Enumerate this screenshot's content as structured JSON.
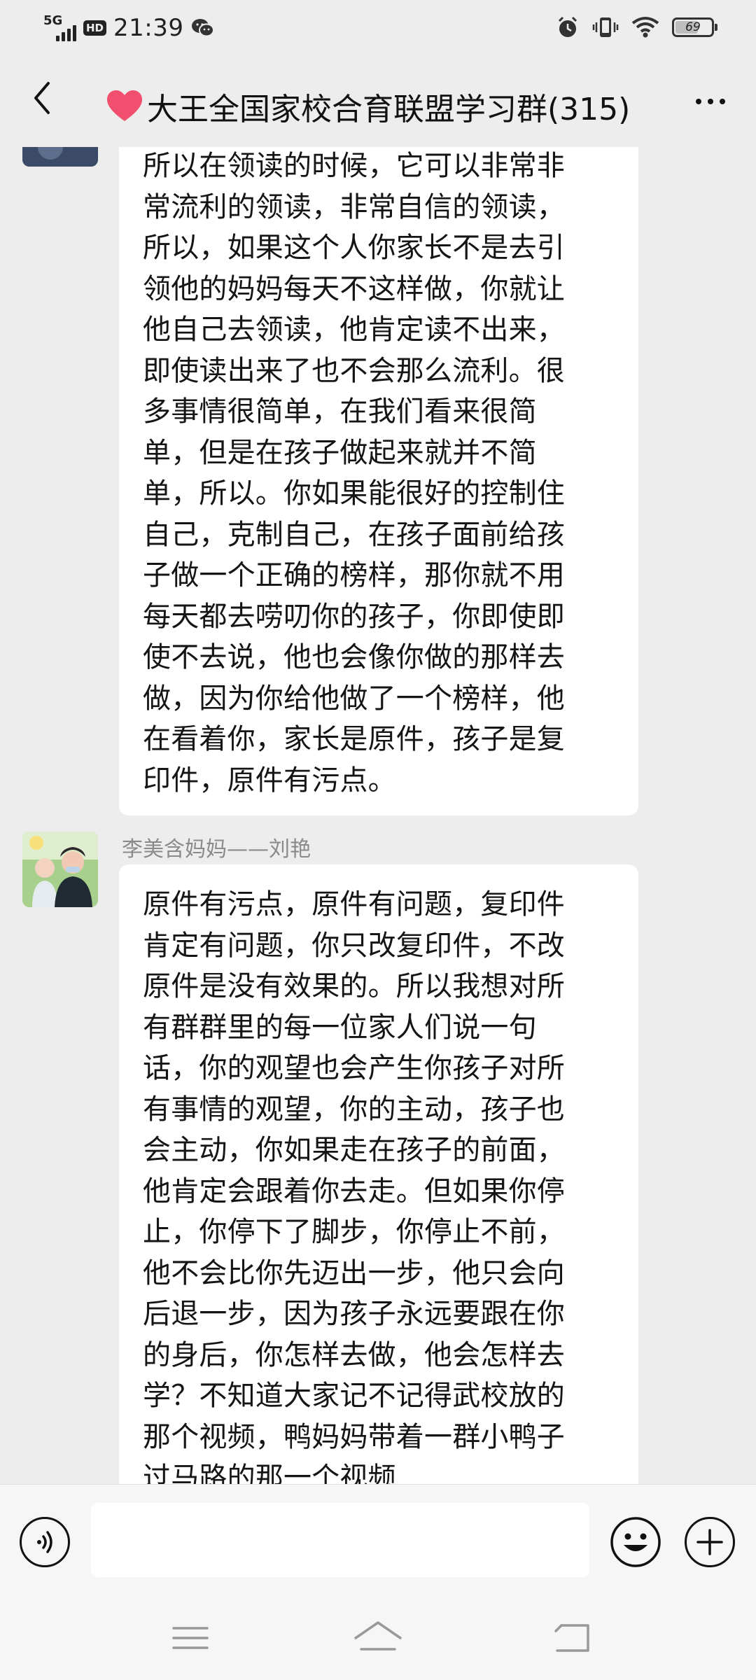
{
  "status_bar": {
    "network": "5G",
    "hd": "HD",
    "time": "21:39",
    "battery": "69",
    "icons": [
      "signal-icon",
      "wechat-icon",
      "alarm-icon",
      "vibrate-icon",
      "wifi-icon",
      "battery-icon"
    ]
  },
  "header": {
    "back_icon": "chevron-left-icon",
    "heart_icon": "heart-icon",
    "title": "大王全国家校合育联盟学习群(315)",
    "more_icon": "more-dots-icon"
  },
  "messages": [
    {
      "sender": "",
      "lines": [
        "所以在领读的时候，它可以非常非",
        "常流利的领读，非常自信的领读，",
        "所以，如果这个人你家长不是去引",
        "领他的妈妈每天不这样做，你就让",
        "他自己去领读，他肯定读不出来，",
        "即使读出来了也不会那么流利。很",
        "多事情很简单，在我们看来很简",
        "单，但是在孩子做起来就并不简",
        "单，所以。你如果能很好的控制住",
        "自己，克制自己，在孩子面前给孩",
        "子做一个正确的榜样，那你就不用",
        "每天都去唠叨你的孩子，你即使即",
        "使不去说，他也会像你做的那样去",
        "做，因为你给他做了一个榜样，他",
        "在看着你，家长是原件，孩子是复",
        "印件，原件有污点。"
      ]
    },
    {
      "sender": "李美含妈妈——刘艳",
      "lines": [
        "原件有污点，原件有问题，复印件",
        "肯定有问题，你只改复印件，不改",
        "原件是没有效果的。所以我想对所",
        "有群群里的每一位家人们说一句",
        "话，你的观望也会产生你孩子对所",
        "有事情的观望，你的主动，孩子也",
        "会主动，你如果走在孩子的前面，",
        "他肯定会跟着你去走。但如果你停",
        "止，你停下了脚步，你停止不前，",
        "他不会比你先迈出一步，他只会向",
        "后退一步，因为孩子永远要跟在你",
        "的身后，你怎样去做，他会怎样去",
        "学？不知道大家记不记得武校放的",
        "那个视频，鸭妈妈带着一群小鸭子",
        "过马路的那一个视频"
      ]
    }
  ],
  "input_bar": {
    "voice_icon": "voice-icon",
    "input_value": "",
    "emoji_icon": "emoji-icon",
    "plus_icon": "plus-icon"
  },
  "nav_bar": {
    "icons": [
      "menu-icon",
      "home-icon",
      "back-icon"
    ]
  },
  "colors": {
    "background": "#ededed",
    "bubble": "#ffffff",
    "sender_name": "#8a8a8a",
    "heart": "#f0506e"
  }
}
